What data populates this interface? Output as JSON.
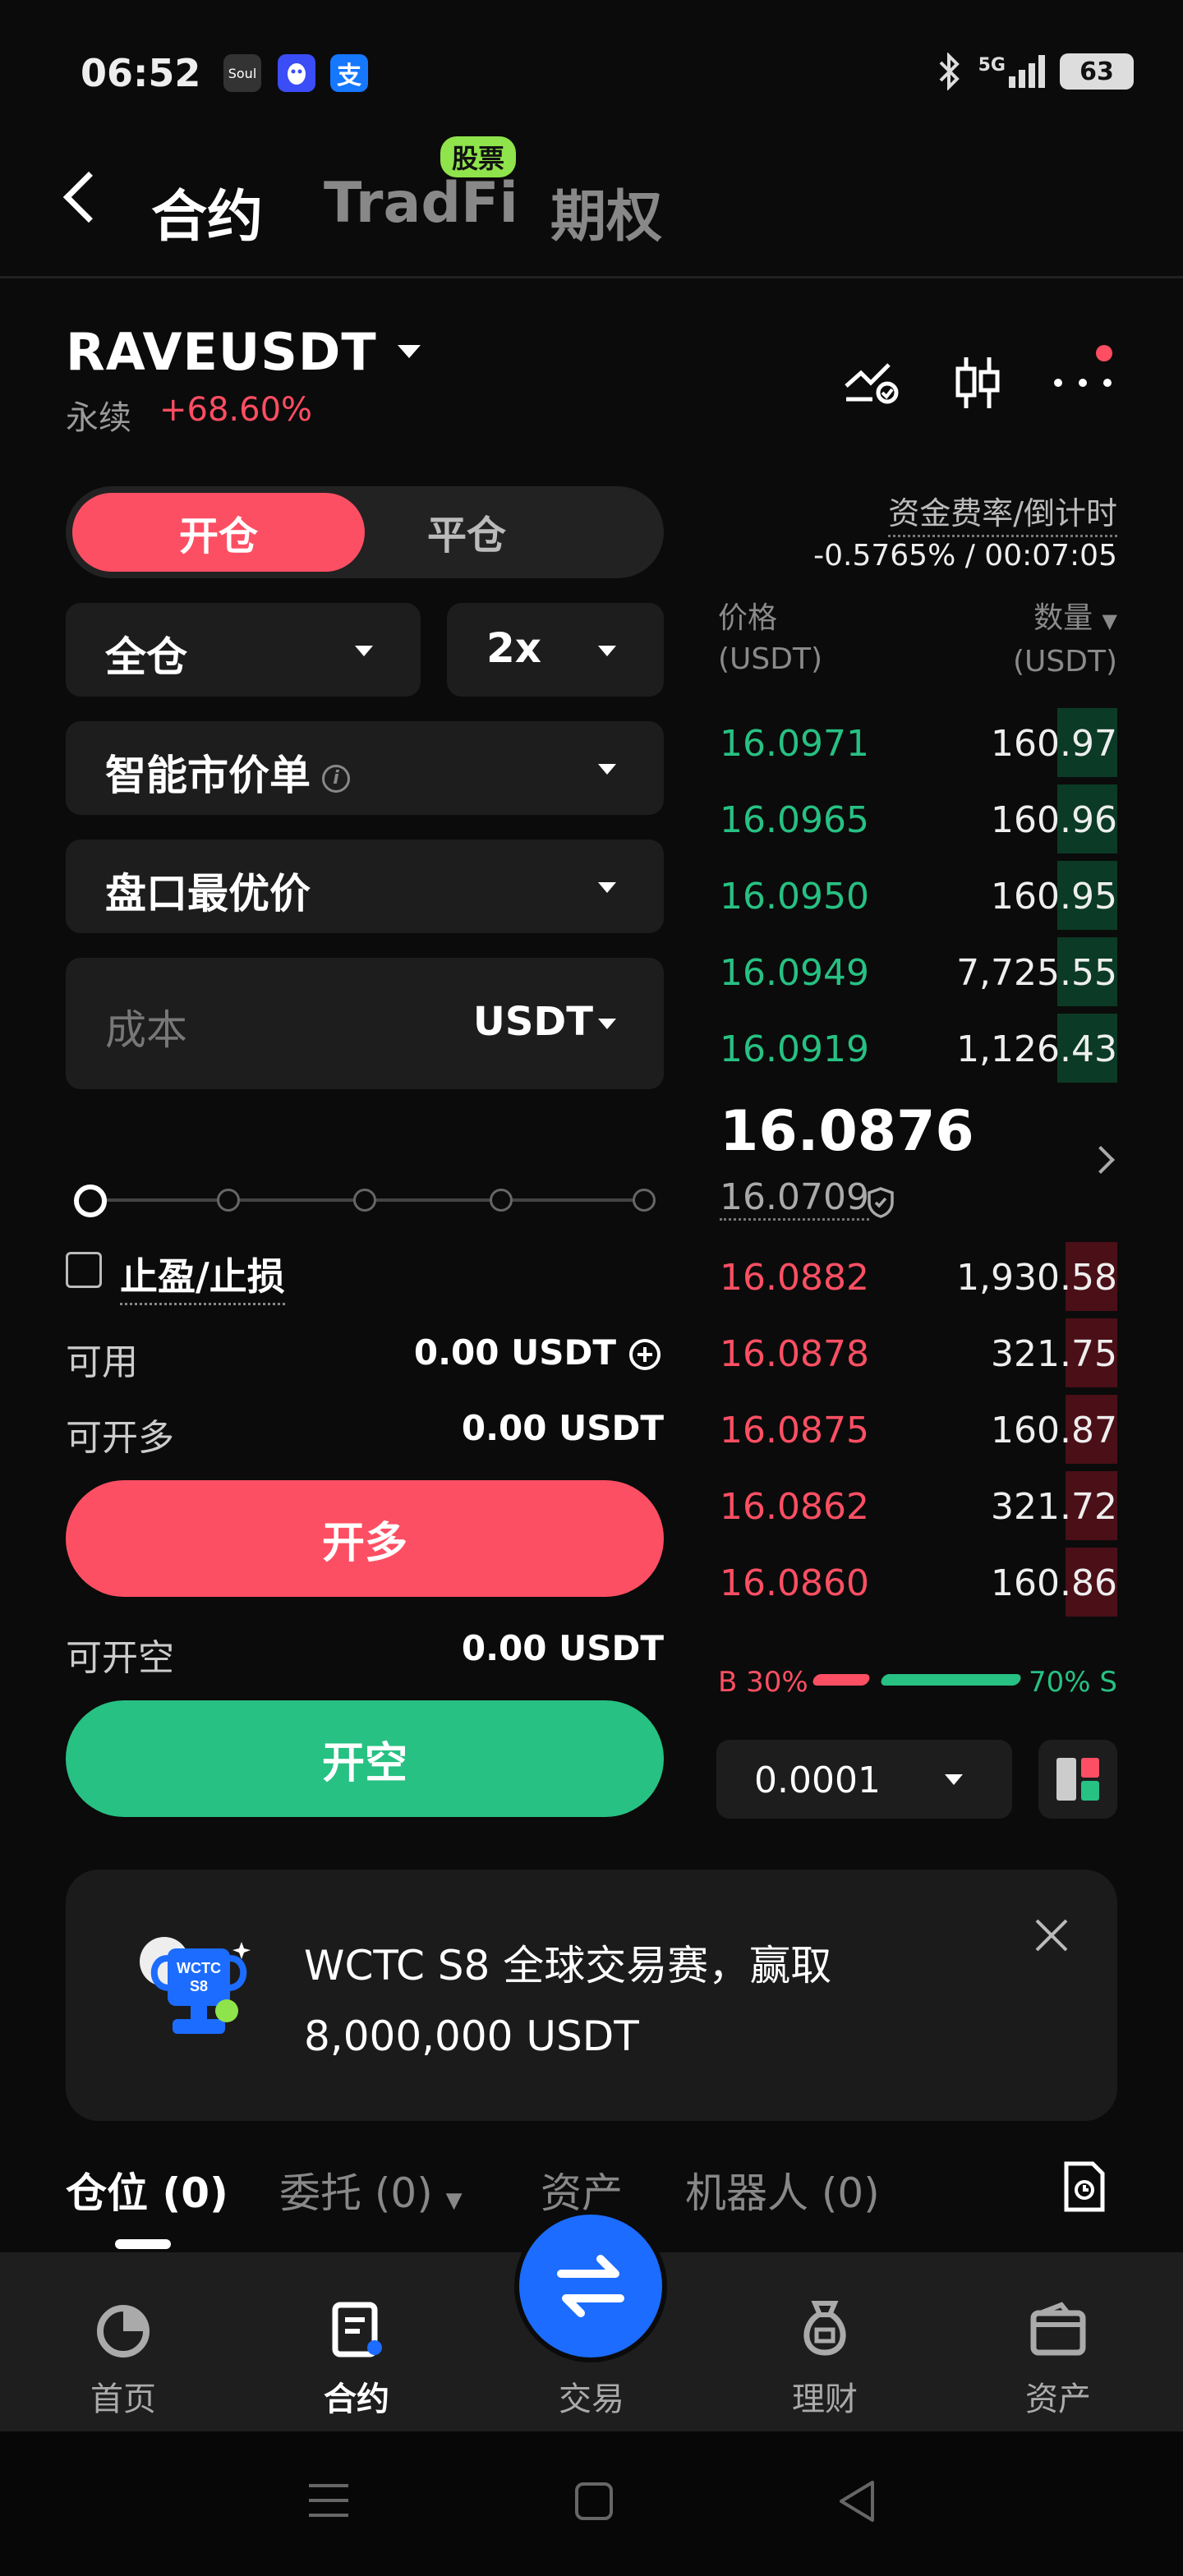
{
  "status_bar": {
    "time": "06:52",
    "apps": [
      "Soul",
      "QQ",
      "支"
    ],
    "network": "5G",
    "battery": "63"
  },
  "top_nav": {
    "tabs": [
      "合约",
      "TradFi",
      "期权"
    ],
    "badge": "股票"
  },
  "symbol": {
    "name": "RAVEUSDT",
    "type": "永续",
    "change": "+68.60%"
  },
  "order_form": {
    "open_label": "开仓",
    "close_label": "平仓",
    "margin_mode": "全仓",
    "leverage": "2x",
    "order_type": "智能市价单",
    "price_mode": "盘口最优价",
    "cost_placeholder": "成本",
    "cost_unit": "USDT",
    "slider_level": 0,
    "tpsl_label": "止盈/止损",
    "available_label": "可用",
    "available_value": "0.00 USDT",
    "max_long_label": "可开多",
    "max_long_value": "0.00 USDT",
    "long_button": "开多",
    "max_short_label": "可开空",
    "max_short_value": "0.00 USDT",
    "short_button": "开空"
  },
  "order_book": {
    "funding_label": "资金费率/倒计时",
    "funding_value": "-0.5765% / 00:07:05",
    "price_header": "价格",
    "price_unit": "(USDT)",
    "qty_header": "数量",
    "qty_unit": "(USDT)",
    "bids": [
      {
        "price": "16.0971",
        "qty": "160.97",
        "depth": 0.15
      },
      {
        "price": "16.0965",
        "qty": "160.96",
        "depth": 0.15
      },
      {
        "price": "16.0950",
        "qty": "160.95",
        "depth": 0.15
      },
      {
        "price": "16.0949",
        "qty": "7,725.55",
        "depth": 0.15
      },
      {
        "price": "16.0919",
        "qty": "1,126.43",
        "depth": 0.15
      }
    ],
    "last_price": "16.0876",
    "mark_price": "16.0709",
    "asks": [
      {
        "price": "16.0882",
        "qty": "1,930.58",
        "depth": 0.13
      },
      {
        "price": "16.0878",
        "qty": "321.75",
        "depth": 0.13
      },
      {
        "price": "16.0875",
        "qty": "160.87",
        "depth": 0.13
      },
      {
        "price": "16.0862",
        "qty": "321.72",
        "depth": 0.13
      },
      {
        "price": "16.0860",
        "qty": "160.86",
        "depth": 0.13
      }
    ],
    "buy_ratio": "B 30%",
    "sell_ratio": "70% S",
    "buy_fraction": 0.3,
    "tick_size": "0.0001"
  },
  "banner": {
    "line1": "WCTC S8 全球交易赛，赢取",
    "line2": "8,000,000 USDT",
    "trophy_text": "WCTC S8"
  },
  "bottom_tabs": [
    "仓位 (0)",
    "委托 (0)",
    "资产",
    "机器人 (0)"
  ],
  "bottom_nav": [
    "首页",
    "合约",
    "交易",
    "理财",
    "资产"
  ],
  "colors": {
    "red": "#fd4f63",
    "green": "#27c183",
    "blue": "#1c6cff"
  }
}
